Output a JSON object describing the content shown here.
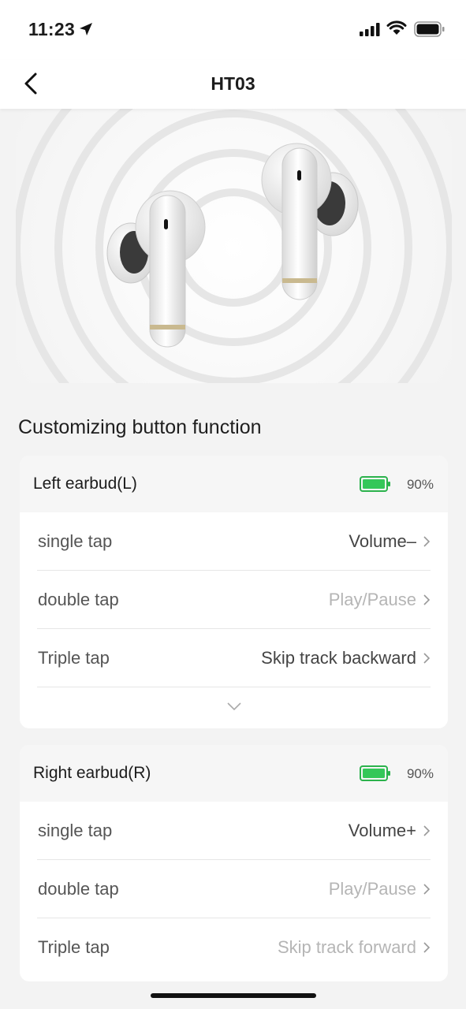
{
  "status_bar": {
    "time": "11:23",
    "battery_icon": "battery-full-icon",
    "signal_icon": "cellular-signal-icon",
    "wifi_icon": "wifi-icon"
  },
  "nav": {
    "title": "HT03",
    "back_icon": "chevron-left-icon"
  },
  "hero": {
    "image": "earbuds-product-image"
  },
  "section_title": "Customizing button function",
  "colors": {
    "battery_green": "#34c759",
    "muted_text": "#b5b5b5",
    "value_text": "#444444"
  },
  "left": {
    "title": "Left earbud(L)",
    "battery": "90%",
    "rows": [
      {
        "label": "single tap",
        "value": "Volume–"
      },
      {
        "label": "double tap",
        "value": "Play/Pause"
      },
      {
        "label": "Triple tap",
        "value": "Skip track backward"
      }
    ],
    "expand_icon": "chevron-down-icon"
  },
  "right": {
    "title": "Right earbud(R)",
    "battery": "90%",
    "rows": [
      {
        "label": "single tap",
        "value": "Volume+"
      },
      {
        "label": "double tap",
        "value": "Play/Pause"
      },
      {
        "label": "Triple tap",
        "value": "Skip track forward"
      }
    ]
  }
}
